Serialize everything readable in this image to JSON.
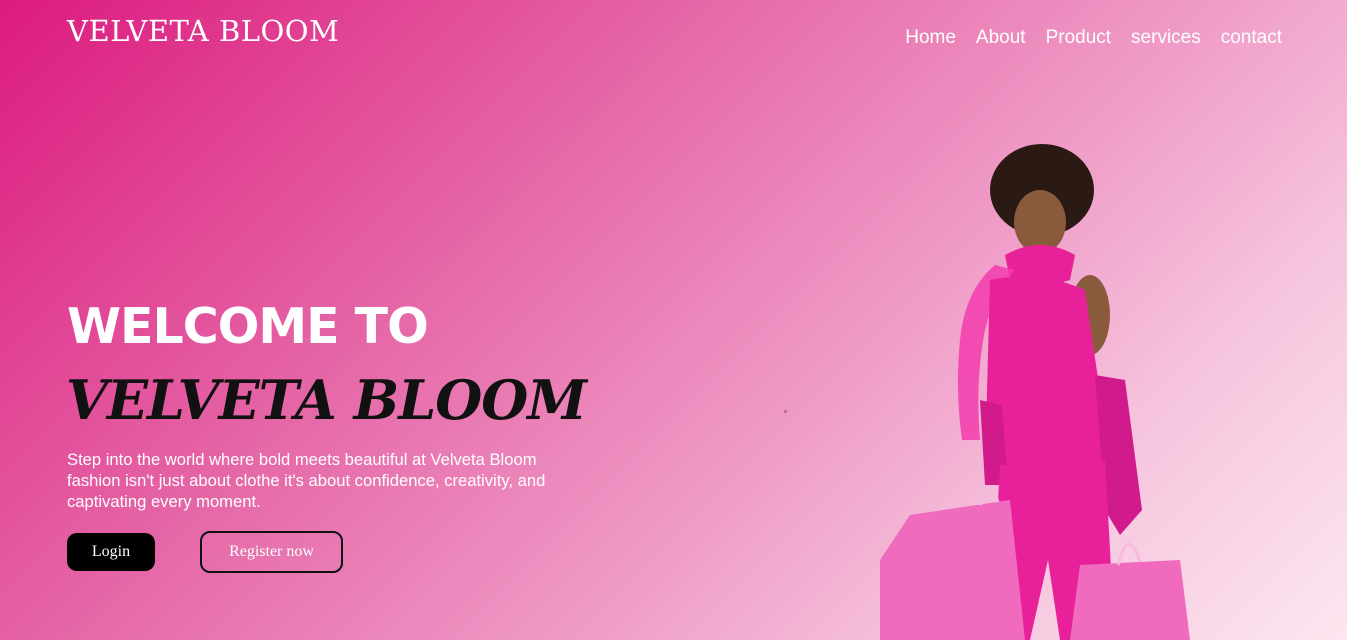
{
  "header": {
    "logo": "VELVETA BLOOM",
    "nav": [
      {
        "label": "Home"
      },
      {
        "label": "About"
      },
      {
        "label": "Product"
      },
      {
        "label": "services"
      },
      {
        "label": "contact"
      }
    ]
  },
  "hero": {
    "title": "WELCOME TO",
    "brand": "VELVETA BLOOM",
    "description": "Step into the world where bold meets beautiful at Velveta Bloom fashion isn't just about clothe it's about confidence, creativity, and captivating every moment.",
    "login_label": "Login",
    "register_label": "Register now"
  },
  "colors": {
    "gradient_start": "#dc1b7f",
    "gradient_end": "#fce6f0",
    "outfit": "#e8219a",
    "bags": "#f06bbd"
  }
}
